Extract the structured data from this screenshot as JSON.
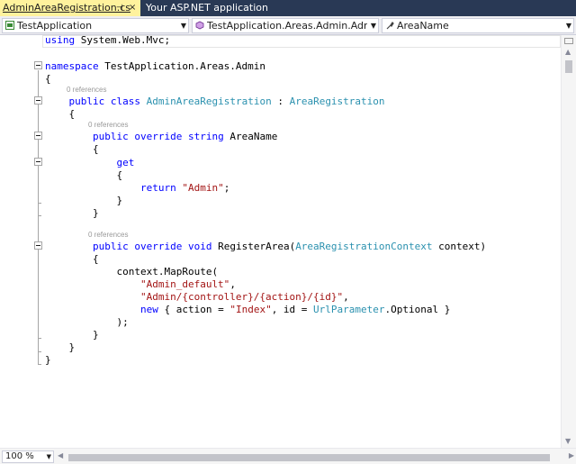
{
  "tabs": [
    {
      "label": "AdminAreaRegistration.cs",
      "pin": "⊣",
      "close": "×"
    },
    {
      "label": "Your ASP.NET application"
    }
  ],
  "nav": {
    "project": "TestApplication",
    "type": "TestApplication.Areas.Admin.AdminAre",
    "member": "AreaName"
  },
  "code": {
    "line1": "using System.Web.Mvc;",
    "ns_kw": "namespace",
    "ns_name": " TestApplication.Areas.Admin",
    "brace_open": "{",
    "brace_close": "}",
    "refs": "0 references",
    "public": "public",
    "class": "class",
    "class_name": "AdminAreaRegistration",
    "colon": " : ",
    "base_type": "AreaRegistration",
    "override": "override",
    "string": "string",
    "prop_name": "AreaName",
    "get": "get",
    "return": "return",
    "admin_str": "\"Admin\"",
    "semicolon": ";",
    "void": "void",
    "method_name": "RegisterArea(",
    "param_type": "AreaRegistrationContext",
    "param_name": " context)",
    "maproute": "context.MapRoute(",
    "route_name": "\"Admin_default\"",
    "route_url": "\"Admin/{controller}/{action}/{id}\"",
    "comma": ",",
    "new": "new",
    "anon_open": " { action = ",
    "index_str": "\"Index\"",
    "id_part": ", id = ",
    "url_param": "UrlParameter",
    "optional": ".Optional }",
    "close_paren": ");"
  },
  "zoom": "100 %"
}
